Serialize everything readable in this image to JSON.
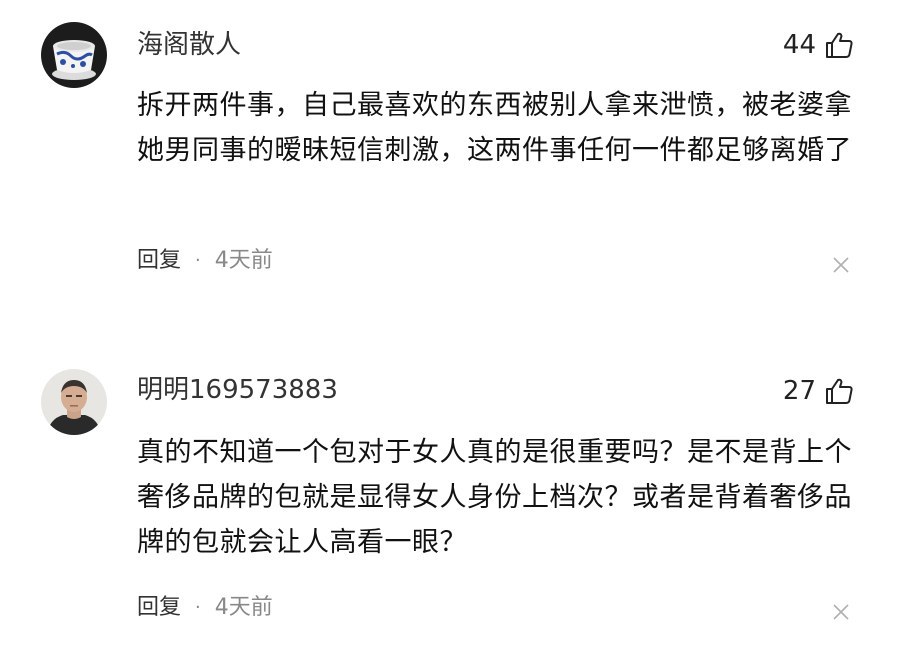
{
  "comments": [
    {
      "username": "海阁散人",
      "likes": "44",
      "text": "拆开两件事，自己最喜欢的东西被别人拿来泄愤，被老婆拿她男同事的暧昧短信刺激，这两件事任何一件都足够离婚了",
      "reply_label": "回复",
      "separator": "·",
      "time": "4天前"
    },
    {
      "username": "明明169573883",
      "likes": "27",
      "text": "真的不知道一个包对于女人真的是很重要吗？是不是背上个奢侈品牌的包就是显得女人身份上档次？或者是背着奢侈品牌的包就会让人高看一眼？",
      "reply_label": "回复",
      "separator": "·",
      "time": "4天前"
    }
  ]
}
